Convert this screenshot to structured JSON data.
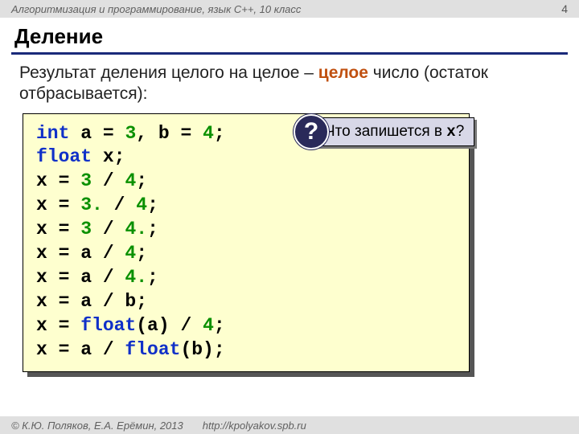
{
  "header": {
    "course": "Алгоритмизация и программирование, язык  C++, 10 класс",
    "page": "4"
  },
  "title": "Деление",
  "lead_pre": "Результат деления целого на целое – ",
  "lead_em": "целое",
  "lead_post": " число (остаток отбрасывается):",
  "code": {
    "l1a": "int",
    "l1b": " a = ",
    "l1c": "3",
    "l1d": ", b = ",
    "l1e": "4",
    "l1f": ";",
    "l2a": "float",
    "l2b": " x;",
    "l3a": "x = ",
    "l3b": "3",
    "l3c": " / ",
    "l3d": "4",
    "l3e": ";",
    "l4a": "x = ",
    "l4b": "3.",
    "l4c": " / ",
    "l4d": "4",
    "l4e": ";",
    "l5a": "x = ",
    "l5b": "3",
    "l5c": " / ",
    "l5d": "4.",
    "l5e": ";",
    "l6a": "x = a / ",
    "l6b": "4",
    "l6c": ";",
    "l7a": "x = a / ",
    "l7b": "4.",
    "l7c": ";",
    "l8a": "x = a / b;",
    "l9a": "x = ",
    "l9b": "float",
    "l9c": "(a) / ",
    "l9d": "4",
    "l9e": ";",
    "l10a": "x = a / ",
    "l10b": "float",
    "l10c": "(b);"
  },
  "callout": {
    "badge": "?",
    "text_pre": " Что запишется в ",
    "text_mono": "x",
    "text_post": "?"
  },
  "footer": {
    "copyright": "© К.Ю. Поляков, Е.А. Ерёмин, 2013",
    "url": "http://kpolyakov.spb.ru"
  }
}
